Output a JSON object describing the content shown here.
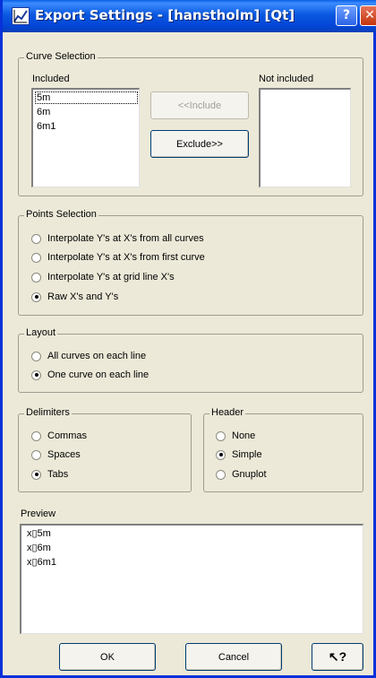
{
  "window": {
    "title": "Export Settings - [hanstholm] [Qt]",
    "help_glyph": "?",
    "close_glyph": "✕"
  },
  "curve_selection": {
    "legend": "Curve Selection",
    "included_label": "Included",
    "not_included_label": "Not included",
    "included_items": [
      "5m",
      "6m",
      "6m1"
    ],
    "selected_item": "5m",
    "include_button": "<<Include",
    "exclude_button": "Exclude>>"
  },
  "points_selection": {
    "legend": "Points Selection",
    "options": [
      {
        "label": "Interpolate Y's at X's from all curves",
        "checked": false
      },
      {
        "label": "Interpolate Y's at X's from first curve",
        "checked": false
      },
      {
        "label": "Interpolate Y's at grid line X's",
        "checked": false
      },
      {
        "label": "Raw X's and Y's",
        "checked": true
      }
    ]
  },
  "layout": {
    "legend": "Layout",
    "options": [
      {
        "label": "All curves on each line",
        "checked": false
      },
      {
        "label": "One curve on each line",
        "checked": true
      }
    ]
  },
  "delimiters": {
    "legend": "Delimiters",
    "options": [
      {
        "label": "Commas",
        "checked": false
      },
      {
        "label": "Spaces",
        "checked": false
      },
      {
        "label": "Tabs",
        "checked": true
      }
    ]
  },
  "header": {
    "legend": "Header",
    "options": [
      {
        "label": "None",
        "checked": false
      },
      {
        "label": "Simple",
        "checked": true
      },
      {
        "label": "Gnuplot",
        "checked": false
      }
    ]
  },
  "preview": {
    "label": "Preview",
    "lines": [
      "x▯5m",
      "x▯6m",
      "x▯6m1"
    ]
  },
  "footer": {
    "ok_label": "OK",
    "cancel_label": "Cancel",
    "whats_this_glyph": "↖?"
  }
}
